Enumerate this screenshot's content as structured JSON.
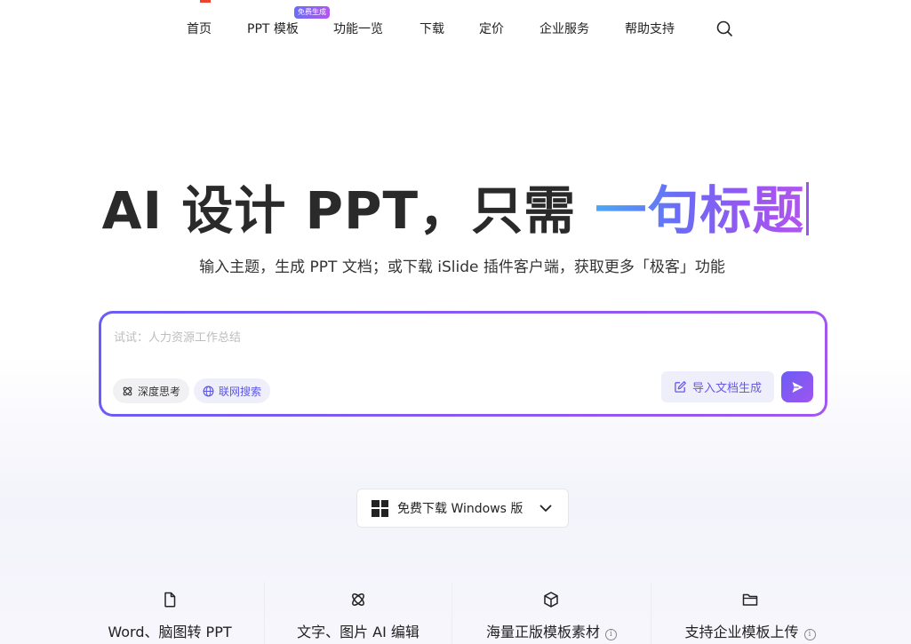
{
  "nav": {
    "items": [
      {
        "label": "首页"
      },
      {
        "label": "PPT 模板"
      },
      {
        "label": "功能一览"
      },
      {
        "label": "下载"
      },
      {
        "label": "定价"
      },
      {
        "label": "企业服务"
      },
      {
        "label": "帮助支持"
      }
    ],
    "badge": "免费生成",
    "search_icon": "search-icon"
  },
  "hero": {
    "title_main": "AI 设计 PPT，只需 ",
    "title_highlight": "一句标题",
    "subtitle": "输入主题，生成 PPT 文档；或下载 iSlide 插件客户端，获取更多「极客」功能"
  },
  "prompt": {
    "placeholder": "试试：人力资源工作总结",
    "value": "",
    "chip_deep": "深度思考",
    "chip_web": "联网搜索",
    "import_label": "导入文档生成",
    "send_icon": "send-icon"
  },
  "download": {
    "label": "免费下载 Windows 版",
    "icon": "windows-icon"
  },
  "features": [
    {
      "label": "Word、脑图转 PPT",
      "icon": "file-icon",
      "info": false
    },
    {
      "label": "文字、图片 AI 编辑",
      "icon": "ai-edit-icon",
      "info": false
    },
    {
      "label": "海量正版模板素材",
      "icon": "box-icon",
      "info": true
    },
    {
      "label": "支持企业模板上传",
      "icon": "folder-icon",
      "info": true
    }
  ],
  "colors": {
    "accent": "#6b5cf6",
    "accent_end": "#a356ef",
    "logo_red": "#e8442f"
  }
}
